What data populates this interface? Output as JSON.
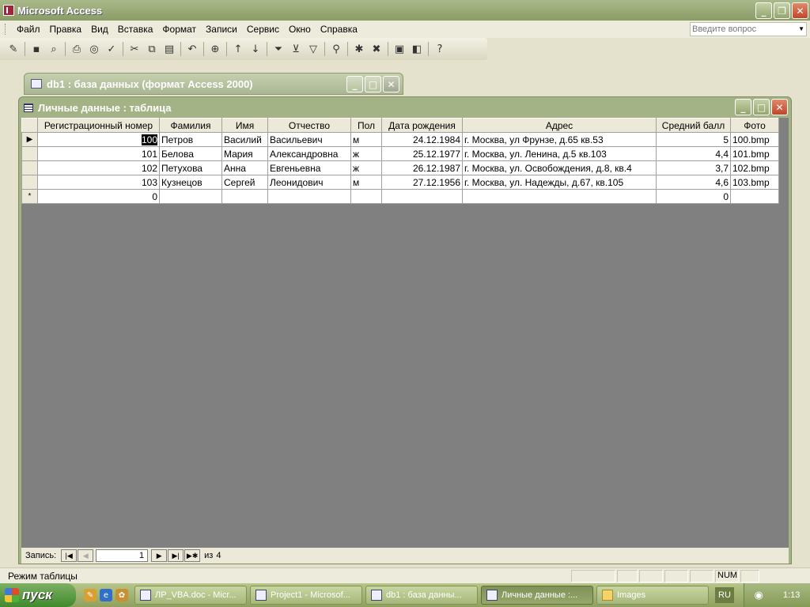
{
  "app": {
    "title": "Microsoft Access"
  },
  "menu": {
    "items": [
      "Файл",
      "Правка",
      "Вид",
      "Вставка",
      "Формат",
      "Записи",
      "Сервис",
      "Окно",
      "Справка"
    ],
    "ask_placeholder": "Введите вопрос"
  },
  "db_window": {
    "title": "db1 : база данных (формат Access 2000)"
  },
  "table_window": {
    "title": "Личные данные : таблица",
    "columns": [
      "Регистрационный номер",
      "Фамилия",
      "Имя",
      "Отчество",
      "Пол",
      "Дата рождения",
      "Адрес",
      "Средний балл",
      "Фото"
    ],
    "rows": [
      {
        "reg": "100",
        "surname": "Петров",
        "name": "Василий",
        "patronymic": "Васильевич",
        "sex": "м",
        "dob": "24.12.1984",
        "address": "г. Москва, ул Фрунзе, д.65 кв.53",
        "avg": "5",
        "photo": "100.bmp"
      },
      {
        "reg": "101",
        "surname": "Белова",
        "name": "Мария",
        "patronymic": "Александровна",
        "sex": "ж",
        "dob": "25.12.1977",
        "address": "г. Москва, ул. Ленина, д.5 кв.103",
        "avg": "4,4",
        "photo": "101.bmp"
      },
      {
        "reg": "102",
        "surname": "Петухова",
        "name": "Анна",
        "patronymic": "Евгеньевна",
        "sex": "ж",
        "dob": "26.12.1987",
        "address": "г. Москва, ул. Освобождения, д.8, кв.4",
        "avg": "3,7",
        "photo": "102.bmp"
      },
      {
        "reg": "103",
        "surname": "Кузнецов",
        "name": "Сергей",
        "patronymic": "Леонидович",
        "sex": "м",
        "dob": "27.12.1956",
        "address": "г. Москва, ул. Надежды, д.67, кв.105",
        "avg": "4,6",
        "photo": "103.bmp"
      }
    ],
    "new_row": {
      "reg": "0",
      "avg": "0",
      "marker": "*"
    },
    "current_marker": "▶",
    "nav": {
      "label": "Запись:",
      "current": "1",
      "of_label": "из",
      "total": "4"
    }
  },
  "status": {
    "mode": "Режим таблицы",
    "num": "NUM"
  },
  "taskbar": {
    "start": "пуск",
    "tasks": [
      "ЛР_VBA.doc - Micr...",
      "Project1 - Microsof...",
      "db1 : база данны...",
      "Личные данные :...",
      "Images"
    ],
    "lang": "RU",
    "clock": "1:13"
  }
}
